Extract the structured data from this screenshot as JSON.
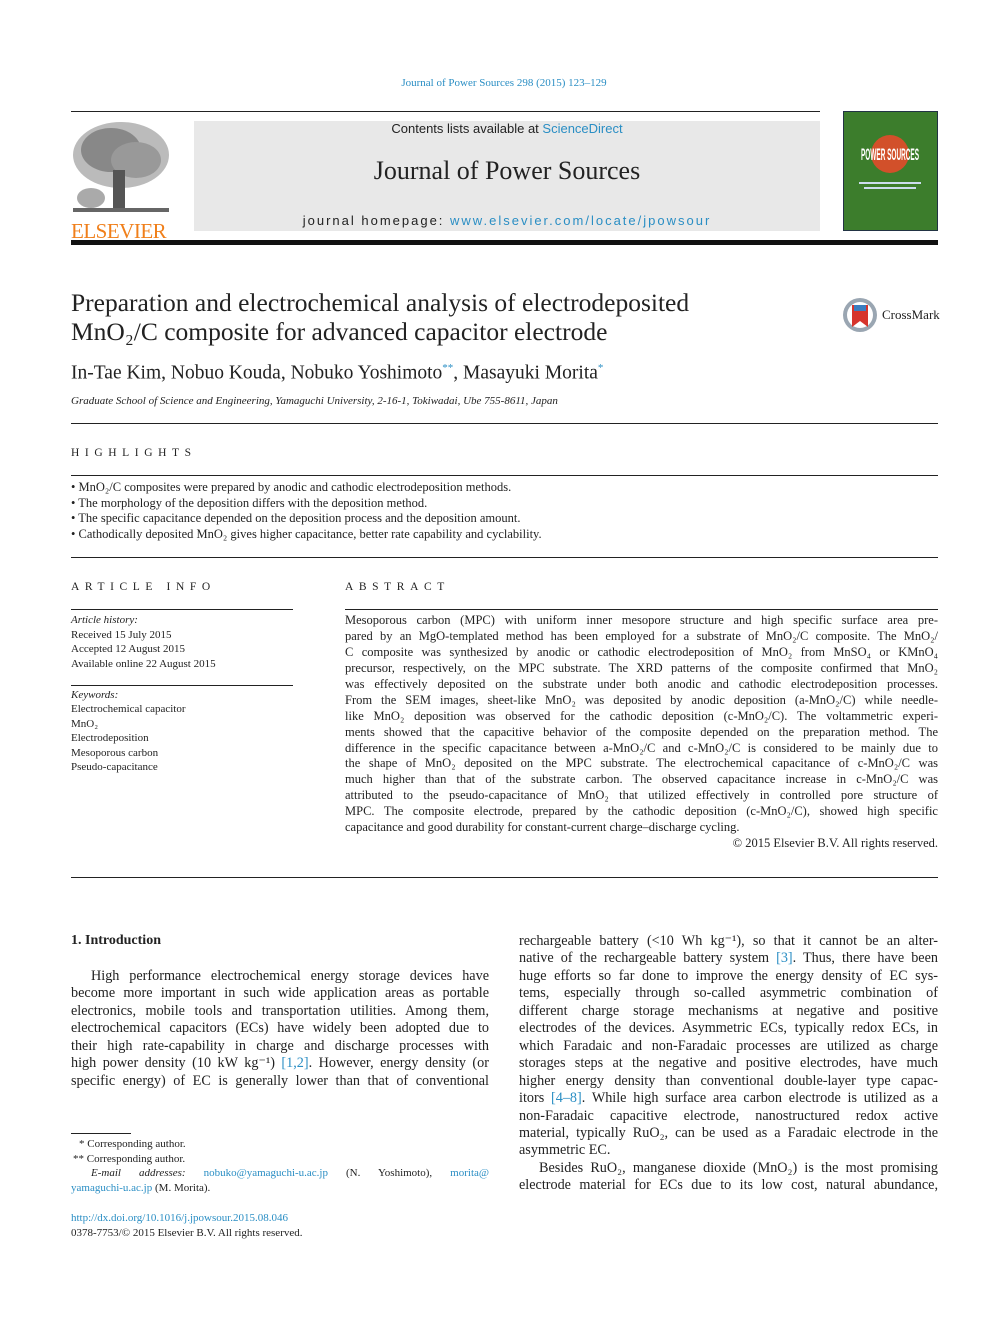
{
  "header": {
    "journal_ref": "Journal of Power Sources 298 (2015) 123–129",
    "contents_prefix": "Contents lists available at ",
    "contents_link": "ScienceDirect",
    "journal_title": "Journal of Power Sources",
    "homepage_prefix": "journal homepage: ",
    "homepage_link": "www.elsevier.com/locate/jpowsour",
    "publisher_logo": "ELSEVIER",
    "cover_text": "POWER SOURCES",
    "crossmark": "CrossMark"
  },
  "colors": {
    "link": "#2a8ec4",
    "elsevier_orange": "#f07f1a",
    "cover_green": "#3c7d2c"
  },
  "article": {
    "title_lines": [
      "Preparation and electrochemical analysis of electrodeposited",
      "MnO₂/C composite for advanced capacitor electrode"
    ],
    "authors_a": "In-Tae Kim, Nobuo Kouda, Nobuko Yoshimoto",
    "authors_a_mark": "**",
    "authors_b": ", Masayuki Morita",
    "authors_b_mark": "*",
    "affiliation": "Graduate School of Science and Engineering, Yamaguchi University, 2-16-1, Tokiwadai, Ube 755-8611, Japan"
  },
  "highlights": {
    "heading": "HIGHLIGHTS",
    "items": [
      "MnO₂/C composites were prepared by anodic and cathodic electrodeposition methods.",
      "The morphology of the deposition differs with the deposition method.",
      "The specific capacitance depended on the deposition process and the deposition amount.",
      "Cathodically deposited MnO₂ gives higher capacitance, better rate capability and cyclability."
    ]
  },
  "article_info": {
    "heading": "ARTICLE INFO",
    "history_label": "Article history:",
    "history": [
      "Received 15 July 2015",
      "Accepted 12 August 2015",
      "Available online 22 August 2015"
    ],
    "keywords_label": "Keywords:",
    "keywords": [
      "Electrochemical capacitor",
      "MnO₂",
      "Electrodeposition",
      "Mesoporous carbon",
      "Pseudo-capacitance"
    ]
  },
  "abstract": {
    "heading": "ABSTRACT",
    "lines": [
      "Mesoporous carbon (MPC) with uniform inner mesopore structure and high specific surface area pre-",
      "pared by an MgO-templated method has been employed for a substrate of MnO₂/C composite. The MnO₂/",
      "C composite was synthesized by anodic or cathodic electrodeposition of MnO₂ from MnSO₄ or KMnO₄",
      "precursor, respectively, on the MPC substrate. The XRD patterns of the composite confirmed that MnO₂",
      "was effectively deposited on the substrate under both anodic and cathodic electrodeposition processes.",
      "From the SEM images, sheet-like MnO₂ was deposited by anodic deposition (a-MnO₂/C) while needle-",
      "like MnO₂ deposition was observed for the cathodic deposition (c-MnO₂/C). The voltammetric experi-",
      "ments showed that the capacitive behavior of the composite depended on the preparation method. The",
      "difference in the specific capacitance between a-MnO₂/C and c-MnO₂/C is considered to be mainly due to",
      "the shape of MnO₂ deposited on the MPC substrate. The electrochemical capacitance of c-MnO₂/C was",
      "much higher than that of the substrate carbon. The observed capacitance increase in c-MnO₂/C was",
      "attributed to the pseudo-capacitance of MnO₂ that utilized effectively in controlled pore structure of",
      "MPC. The composite electrode, prepared by the cathodic deposition (c-MnO₂/C), showed high specific",
      "capacitance and good durability for constant-current charge–discharge cycling."
    ],
    "copyright": "© 2015 Elsevier B.V. All rights reserved."
  },
  "introduction": {
    "heading": "1.  Introduction",
    "left": [
      [
        "High performance electrochemical energy storage devices have"
      ],
      [
        "become more important in such wide application areas as portable"
      ],
      [
        "electronics, mobile tools and transportation utilities. Among them,"
      ],
      [
        "electrochemical capacitors (ECs) have widely been adopted due to"
      ],
      [
        "their high rate-capability in charge and discharge processes with"
      ],
      [
        "high power density (10 kW kg⁻¹) ",
        {
          "ref": "[1,2]"
        },
        ". However, energy density (or"
      ],
      [
        "specific energy) of EC is generally lower than that of conventional"
      ]
    ],
    "right_p1": [
      [
        "rechargeable battery (<10 Wh kg⁻¹), so that it cannot be an alter-"
      ],
      [
        "native of the rechargeable battery system ",
        {
          "ref": "[3]"
        },
        ". Thus, there have been"
      ],
      [
        "huge efforts so far done to improve the energy density of EC sys-"
      ],
      [
        "tems, especially through so-called asymmetric combination of"
      ],
      [
        "different charge storage mechanisms at negative and positive"
      ],
      [
        "electrodes of the devices. Asymmetric ECs, typically redox ECs, in"
      ],
      [
        "which Faradaic and non-Faradaic processes are utilized as charge"
      ],
      [
        "storages steps at the negative and positive electrodes, have much"
      ],
      [
        "higher energy density than conventional double-layer type capac-"
      ],
      [
        "itors ",
        {
          "ref": "[4–8]"
        },
        ". While high surface area carbon electrode is utilized as a"
      ],
      [
        "non-Faradaic capacitive electrode, nanostructured redox active"
      ],
      [
        "material, typically RuO₂, can be used as a Faradaic electrode in the"
      ],
      [
        "asymmetric EC."
      ]
    ],
    "right_p2": [
      [
        "Besides RuO₂, manganese dioxide (MnO₂) is the most promising"
      ],
      [
        "electrode material for ECs due to its low cost, natural abundance,"
      ]
    ]
  },
  "footnotes": {
    "corr1": "*  Corresponding author.",
    "corr2": "**  Corresponding author.",
    "email_label": "E-mail addresses:",
    "email1": "nobuko@yamaguchi-u.ac.jp",
    "email1_name": " (N. Yoshimoto), ",
    "email2_a": "morita@",
    "email2_b": "yamaguchi-u.ac.jp",
    "email2_name": " (M. Morita)."
  },
  "doi": "http://dx.doi.org/10.1016/j.jpowsour.2015.08.046",
  "issn": "0378-7753/© 2015 Elsevier B.V. All rights reserved."
}
